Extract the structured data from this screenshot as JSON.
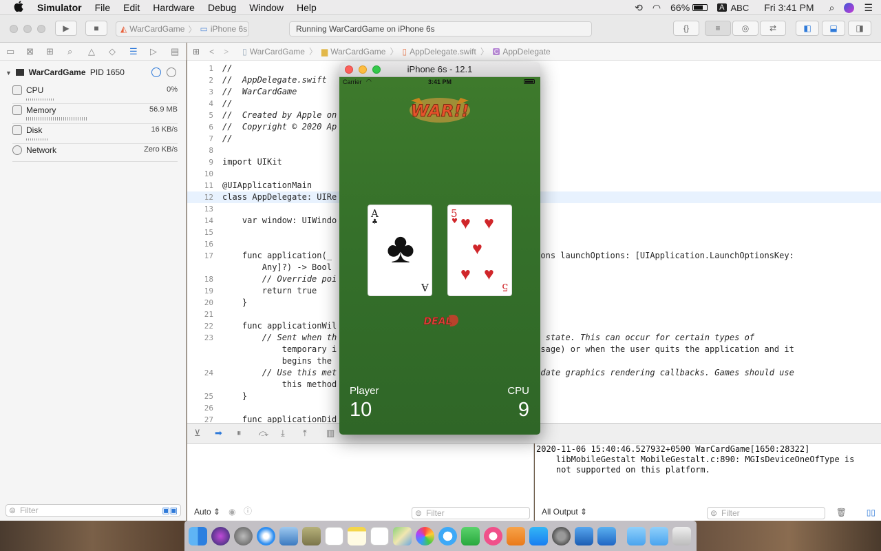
{
  "menubar": {
    "app": "Simulator",
    "menus": [
      "File",
      "Edit",
      "Hardware",
      "Debug",
      "Window",
      "Help"
    ],
    "battery": "66%",
    "input_source": "ABC",
    "clock": "Fri 3:41 PM"
  },
  "toolbar": {
    "scheme": "WarCardGame",
    "device": "iPhone 6s",
    "status": "Running WarCardGame on iPhone 6s"
  },
  "jumpbar": {
    "crumbs": [
      "WarCardGame",
      "WarCardGame",
      "AppDelegate.swift",
      "AppDelegate"
    ]
  },
  "debug_navigator": {
    "process": "WarCardGame",
    "pid": "PID 1650",
    "gauges": [
      {
        "label": "CPU",
        "value": "0%"
      },
      {
        "label": "Memory",
        "value": "56.9 MB"
      },
      {
        "label": "Disk",
        "value": "16 KB/s"
      },
      {
        "label": "Network",
        "value": "Zero KB/s"
      }
    ],
    "filter_placeholder": "Filter"
  },
  "editor": {
    "current_line": 12,
    "lines": [
      {
        "n": "1",
        "text": "//"
      },
      {
        "n": "2",
        "text": "//  AppDelegate.swift"
      },
      {
        "n": "3",
        "text": "//  WarCardGame"
      },
      {
        "n": "4",
        "text": "//"
      },
      {
        "n": "5",
        "text": "//  Created by Apple on"
      },
      {
        "n": "6",
        "text": "//  Copyright © 2020 Ap"
      },
      {
        "n": "7",
        "text": "//"
      },
      {
        "n": "8",
        "text": ""
      },
      {
        "n": "9",
        "text": "import UIKit"
      },
      {
        "n": "10",
        "text": ""
      },
      {
        "n": "11",
        "text": "@UIApplicationMain"
      },
      {
        "n": "12",
        "text": "class AppDelegate: UIRe"
      },
      {
        "n": "13",
        "text": ""
      },
      {
        "n": "14",
        "text": "    var window: UIWindo"
      },
      {
        "n": "15",
        "text": ""
      },
      {
        "n": "16",
        "text": ""
      },
      {
        "n": "17",
        "text": "    func application(_                           unchingWithOptions launchOptions: [UIApplication.LaunchOptionsKey:"
      },
      {
        "n": "",
        "text": "        Any]?) -> Bool"
      },
      {
        "n": "18",
        "text": "        // Override poi                          launch."
      },
      {
        "n": "19",
        "text": "        return true"
      },
      {
        "n": "20",
        "text": "    }"
      },
      {
        "n": "21",
        "text": ""
      },
      {
        "n": "22",
        "text": "    func applicationWil                          tion) {"
      },
      {
        "n": "23",
        "text": "        // Sent when th                          ive to inactive state. This can occur for certain types of"
      },
      {
        "n": "",
        "text": "            temporary i                          call or SMS message) or when the user quits the application and it"
      },
      {
        "n": "",
        "text": "            begins the"
      },
      {
        "n": "24",
        "text": "        // Use this met                          ers, and invalidate graphics rendering callbacks. Games should use"
      },
      {
        "n": "",
        "text": "            this method"
      },
      {
        "n": "25",
        "text": "    }"
      },
      {
        "n": "26",
        "text": ""
      },
      {
        "n": "27",
        "text": "    func applicationDid                          ation) {"
      }
    ]
  },
  "debug_area": {
    "auto_label": "Auto",
    "filter_placeholder": "Filter",
    "output_label": "All Output",
    "console_lines": [
      "2020-11-06 15:40:46.527932+0500 WarCardGame[1650:28322]",
      "    libMobileGestalt MobileGestalt.c:890: MGIsDeviceOneOfType is",
      "    not supported on this platform."
    ]
  },
  "simulator": {
    "title": "iPhone 6s - 12.1",
    "status_bar": {
      "carrier": "Carrier",
      "time": "3:41 PM"
    },
    "logo_text": "WAR!!",
    "deal_label": "DEAL",
    "left_card": {
      "rank": "A",
      "suit": "♣",
      "color": "#111111"
    },
    "right_card": {
      "rank": "5",
      "suit": "♥",
      "color": "#d0262a"
    },
    "player_label": "Player",
    "player_score": "10",
    "cpu_label": "CPU",
    "cpu_score": "9"
  }
}
